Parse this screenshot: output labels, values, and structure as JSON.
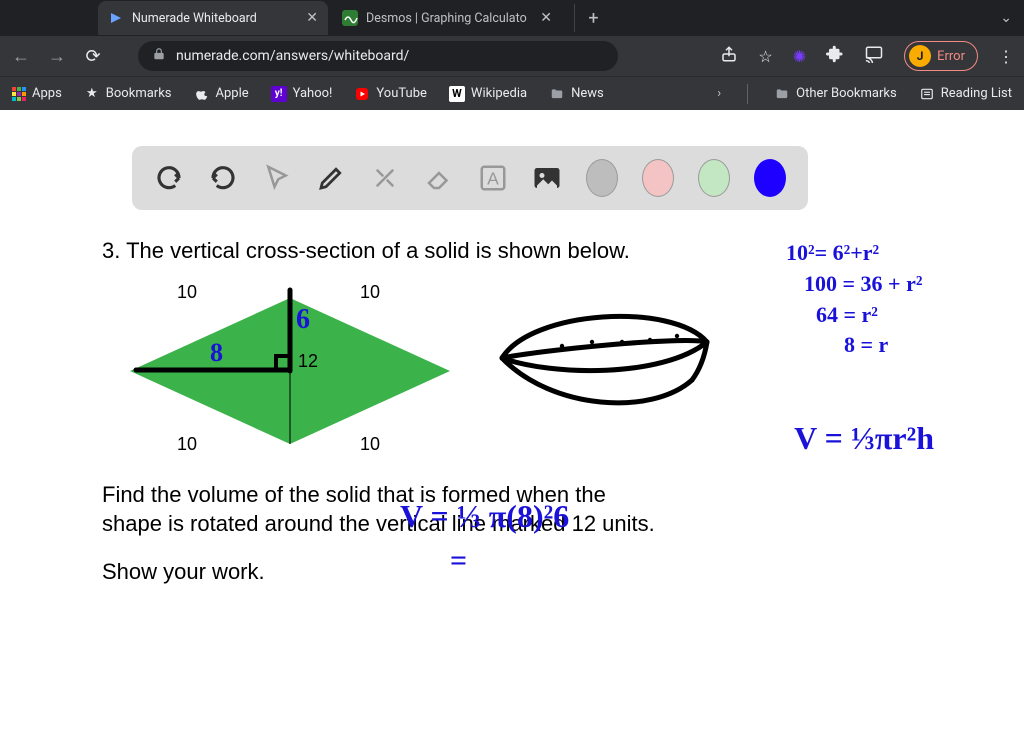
{
  "browser": {
    "tabs": [
      {
        "title": "Numerade Whiteboard",
        "active": true
      },
      {
        "title": "Desmos | Graphing Calculato",
        "active": false
      }
    ],
    "url": "numerade.com/answers/whiteboard/",
    "profile": {
      "initial": "J",
      "status": "Error"
    }
  },
  "bookmarks": {
    "apps": "Apps",
    "items": [
      "Bookmarks",
      "Apple",
      "Yahoo!",
      "YouTube",
      "Wikipedia",
      "News"
    ],
    "right": {
      "other": "Other Bookmarks",
      "reading": "Reading List"
    }
  },
  "whiteboard": {
    "tools": [
      "undo",
      "redo",
      "cursor",
      "pen",
      "settings",
      "eraser",
      "text",
      "image"
    ],
    "colors": [
      "gray",
      "pink",
      "green",
      "blue"
    ]
  },
  "problem": {
    "number": "3.",
    "title": "The vertical cross-section of a solid is shown below.",
    "edge": "10",
    "diagonal": "12",
    "prompt": "Find the volume of the solid that is formed when the shape is rotated around the vertical line marked 12 units.",
    "show_work": "Show your work."
  },
  "handwriting": {
    "six": "6",
    "eight": "8",
    "calc": [
      "10²= 6²+r²",
      "100 = 36 + r²",
      "64 = r²",
      "8 = r"
    ],
    "vformula": "V = ⅓πr²h",
    "vplug": "V = ⅓ π(8)²6",
    "equals": "="
  }
}
